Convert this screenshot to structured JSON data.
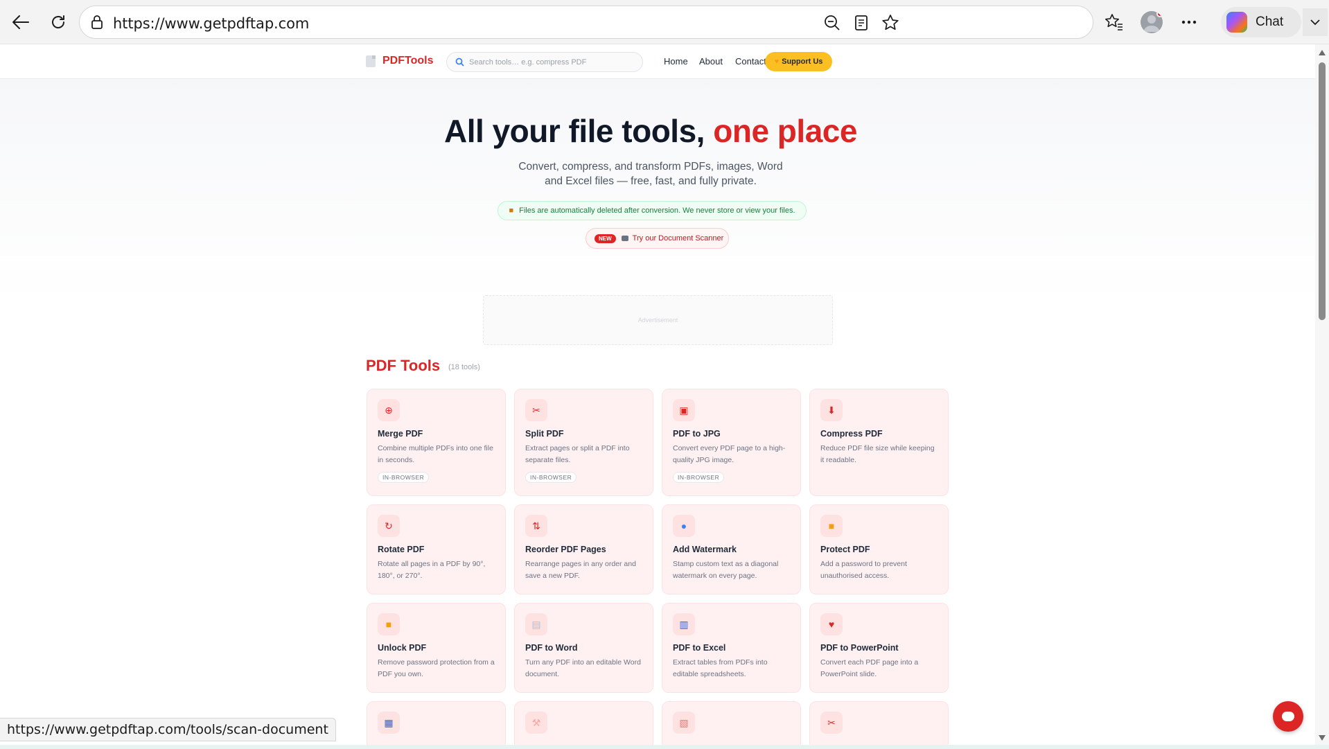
{
  "browser": {
    "url": "https://www.getpdftap.com",
    "chat_label": "Chat",
    "status_url": "https://www.getpdftap.com/tools/scan-document"
  },
  "site": {
    "brand": "PDFTools",
    "search_placeholder": "Search tools… e.g. compress PDF",
    "nav": [
      "Home",
      "About",
      "Contact"
    ],
    "support_label": "Support Us"
  },
  "hero": {
    "title_main": "All your file tools, ",
    "title_accent": "one place",
    "subtitle": "Convert, compress, and transform PDFs, images, Word and Excel files — free, fast, and fully private.",
    "privacy_note": "Files are automatically deleted after conversion. We never store or view your files.",
    "new_badge": "NEW",
    "scanner_label": "Try our Document Scanner"
  },
  "ad_label": "Advertisement",
  "section": {
    "title": "PDF Tools",
    "count": "(18 tools)"
  },
  "tools": [
    {
      "name": "Merge PDF",
      "desc": "Combine multiple PDFs into one file in seconds.",
      "badge": "IN-BROWSER",
      "icon": "merge-icon",
      "glyph": "⊕",
      "color": "#dc2626"
    },
    {
      "name": "Split PDF",
      "desc": "Extract pages or split a PDF into separate files.",
      "badge": "IN-BROWSER",
      "icon": "scissors-icon",
      "glyph": "✂",
      "color": "#dc2626"
    },
    {
      "name": "PDF to JPG",
      "desc": "Convert every PDF page to a high-quality JPG image.",
      "badge": "IN-BROWSER",
      "icon": "image-icon",
      "glyph": "▣",
      "color": "#dc2626"
    },
    {
      "name": "Compress PDF",
      "desc": "Reduce PDF file size while keeping it readable.",
      "badge": "",
      "icon": "arrow-down-icon",
      "glyph": "⬇",
      "color": "#dc2626"
    },
    {
      "name": "Rotate PDF",
      "desc": "Rotate all pages in a PDF by 90°, 180°, or 270°.",
      "badge": "",
      "icon": "rotate-icon",
      "glyph": "↻",
      "color": "#dc2626"
    },
    {
      "name": "Reorder PDF Pages",
      "desc": "Rearrange pages in any order and save a new PDF.",
      "badge": "",
      "icon": "reorder-icon",
      "glyph": "⇅",
      "color": "#dc2626"
    },
    {
      "name": "Add Watermark",
      "desc": "Stamp custom text as a diagonal watermark on every page.",
      "badge": "",
      "icon": "droplet-icon",
      "glyph": "●",
      "color": "#3b82f6"
    },
    {
      "name": "Protect PDF",
      "desc": "Add a password to prevent unauthorised access.",
      "badge": "",
      "icon": "lock-icon",
      "glyph": "■",
      "color": "#f59e0b"
    },
    {
      "name": "Unlock PDF",
      "desc": "Remove password protection from a PDF you own.",
      "badge": "",
      "icon": "unlock-icon",
      "glyph": "■",
      "color": "#f59e0b"
    },
    {
      "name": "PDF to Word",
      "desc": "Turn any PDF into an editable Word document.",
      "badge": "",
      "icon": "word-doc-icon",
      "glyph": "▤",
      "color": "#93c5fd"
    },
    {
      "name": "PDF to Excel",
      "desc": "Extract tables from PDFs into editable spreadsheets.",
      "badge": "",
      "icon": "chart-icon",
      "glyph": "▥",
      "color": "#2563eb"
    },
    {
      "name": "PDF to PowerPoint",
      "desc": "Convert each PDF page into a PowerPoint slide.",
      "badge": "",
      "icon": "heart-icon",
      "glyph": "♥",
      "color": "#dc2626"
    },
    {
      "name": "",
      "desc": "",
      "badge": "",
      "icon": "grid-icon",
      "glyph": "▦",
      "color": "#2563eb"
    },
    {
      "name": "",
      "desc": "",
      "badge": "",
      "icon": "wrench-icon",
      "glyph": "⚒",
      "color": "#fca5a5"
    },
    {
      "name": "",
      "desc": "",
      "badge": "",
      "icon": "edit-doc-icon",
      "glyph": "▧",
      "color": "#f87171"
    },
    {
      "name": "",
      "desc": "",
      "badge": "",
      "icon": "ribbon-icon",
      "glyph": "✂",
      "color": "#dc2626"
    }
  ]
}
